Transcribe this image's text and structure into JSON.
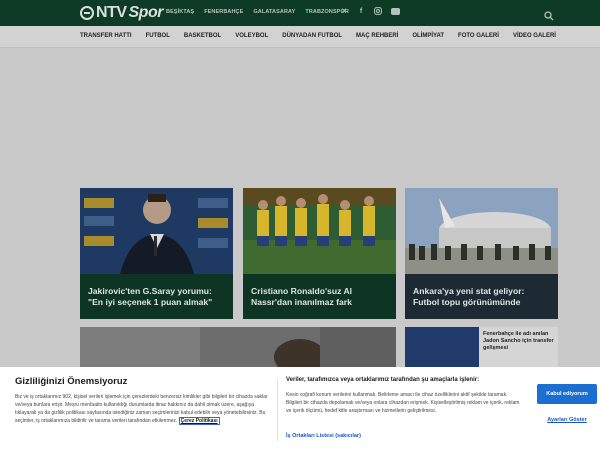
{
  "header": {
    "logo_text": "NTV",
    "logo_sub": "Spor",
    "top_links": [
      "BEŞİKTAŞ",
      "FENERBAHÇE",
      "GALATASARAY",
      "TRABZONSPOR"
    ],
    "social_icons": [
      "x-icon",
      "facebook-icon",
      "instagram-icon",
      "youtube-icon"
    ]
  },
  "nav": {
    "items": [
      "TRANSFER HATTI",
      "FUTBOL",
      "BASKETBOL",
      "VOLEYBOL",
      "DÜNYADAN FUTBOL",
      "MAÇ REHBERİ",
      "OLİMPİYAT",
      "FOTO GALERİ",
      "VİDEO GALERİ"
    ]
  },
  "cards": [
    {
      "title": "Jakirovic'ten G.Saray yorumu: \"En iyi seçenek 1 puan almak\""
    },
    {
      "title": "Cristiano Ronaldo'suz Al Nassr'dan inanılmaz fark"
    },
    {
      "title": "Ankara'ya yeni stat geliyor: Futbol topu görünümünde"
    }
  ],
  "side_news": {
    "text": "Fenerbahçe ile adı anılan Jadon Sancho için transfer gelişmesi"
  },
  "consent": {
    "title": "Gizliliğinizi Önemsiyoruz",
    "left_text": "Biz ve iş ortaklarımız 902, kişisel verileri işlemek için çerezlerdeki benzersiz kimlikler gibi bilgileri bir cihazda saklar ve/veya bunlara erişir. Meşru menfaatin kullanıldığı durumlarda itiraz hakkınız da dahil olmak üzere, aşağıya tıklayarak ya da gizlilik politikası sayfasında istediğiniz zaman seçimlerinizi kabul edebilir veya yönetebilirsiniz. Bu seçimler, iş ortaklarımıza bildirilir ve tarama verileri tarafından etkilenmez.",
    "policy_link": "Çerez Politikası",
    "right_title": "Veriler, tarafımızca veya ortaklarımız tarafından şu amaçlarla işlenir:",
    "right_text": "Kesin coğrafi konum verilerini kullanmak. Belirleme amacı ile cihaz özelliklerini aktif şekilde taramak. Bilgileri bir cihazda depolamak ve/veya onlara cihazdan erişmek. Kişiselleştirilmiş reklam ve içerik, reklam ve içerik ölçümü, hedef kitle araştırması ve hizmetlerin geliştirilmesi.",
    "partners_link": "İş Ortakları Listesi (sakıcılar)",
    "accept_label": "Kabul ediyorum",
    "options_label": "Ayarları Göster"
  }
}
